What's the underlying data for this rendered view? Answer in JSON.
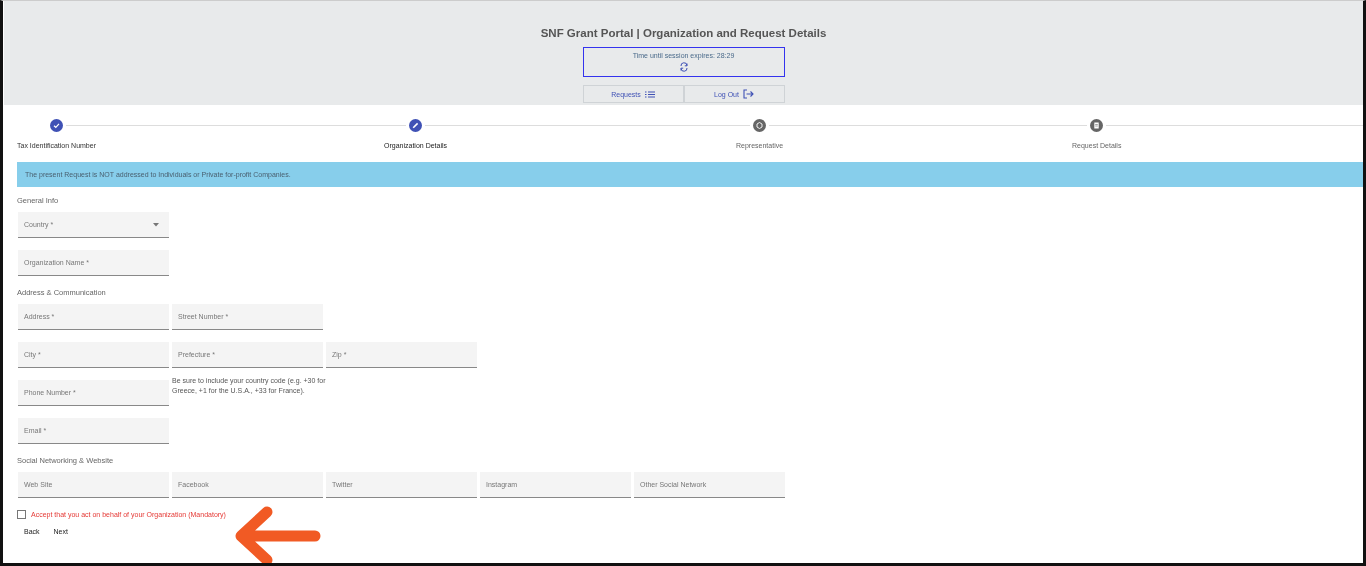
{
  "header": {
    "title": "SNF Grant Portal | Organization and Request Details",
    "session": "Time until session expires: 28:29",
    "nav": [
      {
        "label": "Requests",
        "kind": "list"
      },
      {
        "label": "Log Out",
        "kind": "logout"
      }
    ]
  },
  "steps": [
    {
      "label": "Tax Identification Number",
      "completed": true,
      "selected": false
    },
    {
      "label": "Organization Details",
      "completed": false,
      "selected": true
    },
    {
      "label": "Representative",
      "completed": false,
      "selected": false,
      "kind": "badge"
    },
    {
      "label": "Request Details",
      "completed": false,
      "selected": false,
      "kind": "doc"
    }
  ],
  "notice": "The present Request is NOT addressed to Individuals or Private for-profit Companies.",
  "sections": [
    {
      "title": "General Info",
      "rows": [
        {
          "fields": [
            {
              "placeholder": "Country *",
              "kind": "select"
            }
          ]
        },
        {
          "fields": [
            {
              "placeholder": "Organization Name *",
              "kind": "text"
            }
          ]
        }
      ]
    },
    {
      "title": "Address & Communication",
      "rows": [
        {
          "fields": [
            {
              "placeholder": "Address *",
              "kind": "text"
            },
            {
              "placeholder": "Street Number *",
              "kind": "text"
            }
          ]
        },
        {
          "fields": [
            {
              "placeholder": "City *",
              "kind": "text"
            },
            {
              "placeholder": "Prefecture *",
              "kind": "text"
            },
            {
              "placeholder": "Zip *",
              "kind": "text"
            }
          ]
        },
        {
          "fields": [
            {
              "placeholder": "Phone Number *",
              "kind": "text"
            }
          ],
          "hint": "Be sure to include your country code (e.g. +30 for Greece, +1 for the U.S.A., +33 for France)."
        },
        {
          "fields": [
            {
              "placeholder": "Email *",
              "kind": "text"
            }
          ]
        }
      ]
    },
    {
      "title": "Social Networking & Website",
      "rows": [
        {
          "fields": [
            {
              "placeholder": "Web Site",
              "kind": "text"
            },
            {
              "placeholder": "Facebook",
              "kind": "text"
            },
            {
              "placeholder": "Twitter",
              "kind": "text"
            },
            {
              "placeholder": "Instagram",
              "kind": "text"
            },
            {
              "placeholder": "Other Social Network",
              "kind": "text"
            }
          ]
        }
      ]
    }
  ],
  "accept": {
    "label": "Accept that you act on behalf of your Organization (Mandatory)",
    "checked": false
  },
  "buttons": [
    "Back",
    "Next"
  ]
}
